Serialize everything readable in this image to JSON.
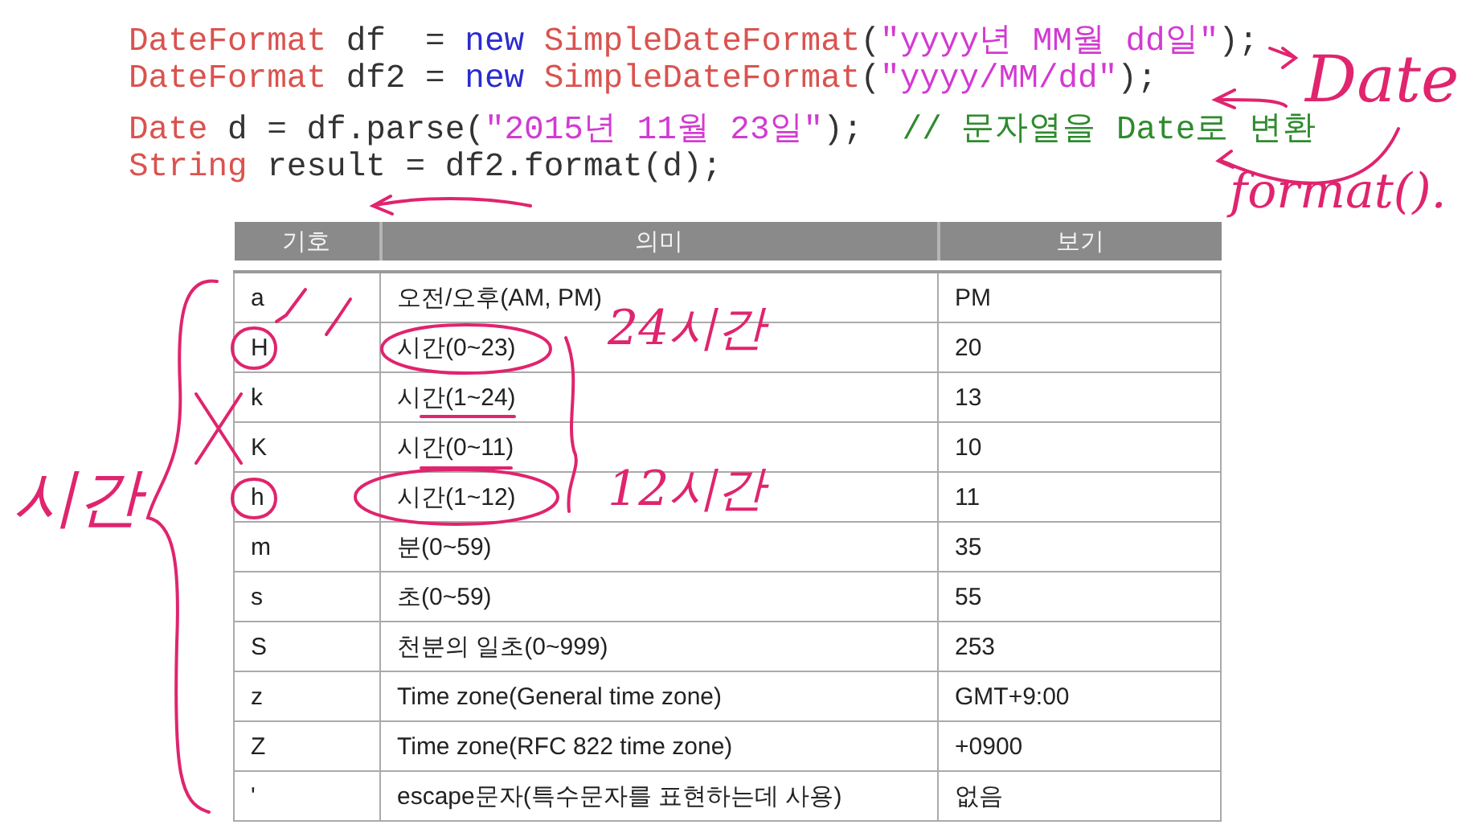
{
  "code_lines": [
    {
      "tokens": [
        {
          "kind": "type",
          "text": "DateFormat"
        },
        {
          "kind": "plain",
          "text": " df  = "
        },
        {
          "kind": "keyword",
          "text": "new"
        },
        {
          "kind": "type",
          "text": "SimpleDateFormat"
        },
        {
          "kind": "plain",
          "text": "("
        },
        {
          "kind": "string",
          "text": "\"yyyy년 MM월 dd일\""
        },
        {
          "kind": "plain",
          "text": ");"
        }
      ]
    },
    {
      "tokens": [
        {
          "kind": "type",
          "text": "DateFormat"
        },
        {
          "kind": "plain",
          "text": " df2 = "
        },
        {
          "kind": "keyword",
          "text": "new"
        },
        {
          "kind": "type",
          "text": "SimpleDateFormat"
        },
        {
          "kind": "plain",
          "text": "("
        },
        {
          "kind": "string",
          "text": "\"yyyy/MM/dd\""
        },
        {
          "kind": "plain",
          "text": ");"
        }
      ]
    },
    {
      "tokens": [
        {
          "kind": "type",
          "text": "Date"
        },
        {
          "kind": "plain",
          "text": " d = df.parse("
        },
        {
          "kind": "string",
          "text": "\"2015년 11월 23일\""
        },
        {
          "kind": "plain",
          "text": ");  "
        },
        {
          "kind": "comment",
          "text": "// 문자열을 Date로 변환"
        }
      ]
    },
    {
      "tokens": [
        {
          "kind": "type",
          "text": "String"
        },
        {
          "kind": "plain",
          "text": " result = df2.format(d);"
        }
      ]
    }
  ],
  "table": {
    "columns": [
      "기호",
      "의미",
      "보기"
    ],
    "rows": [
      [
        "a",
        "오전/오후(AM, PM)",
        "PM"
      ],
      [
        "H",
        "시간(0~23)",
        "20"
      ],
      [
        "k",
        "시간(1~24)",
        "13"
      ],
      [
        "K",
        "시간(0~11)",
        "10"
      ],
      [
        "h",
        "시간(1~12)",
        "11"
      ],
      [
        "m",
        "분(0~59)",
        "35"
      ],
      [
        "s",
        "초(0~59)",
        "55"
      ],
      [
        "S",
        "천분의 일초(0~999)",
        "253"
      ],
      [
        "z",
        "Time zone(General time zone)",
        "GMT+9:00"
      ],
      [
        "Z",
        "Time zone(RFC 822 time zone)",
        "+0900"
      ],
      [
        "'",
        "escape문자(특수문자를 표현하는데 사용)",
        "없음"
      ]
    ]
  },
  "handwriting": [
    "Date",
    "format().",
    "24시간",
    "12시간",
    "시간"
  ]
}
